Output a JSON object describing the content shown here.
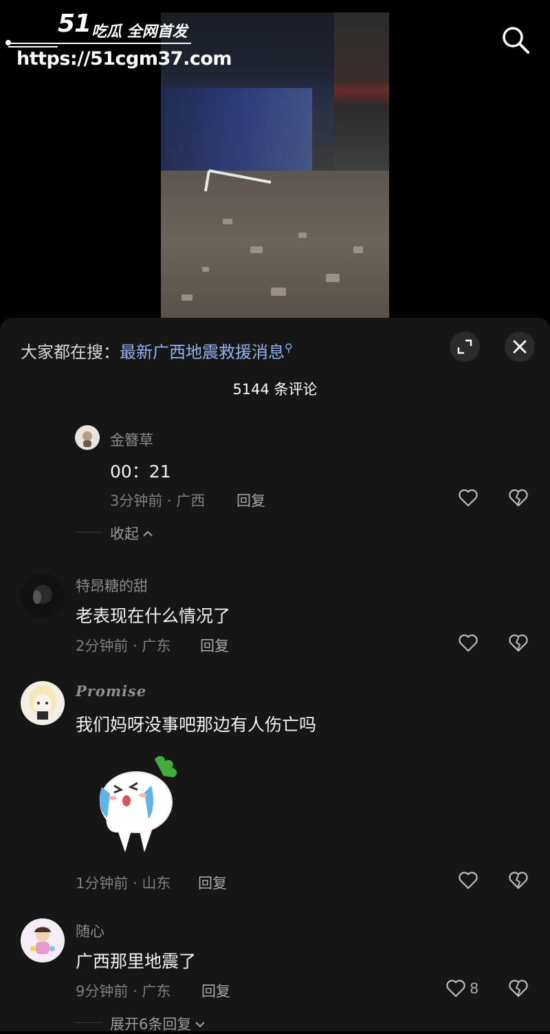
{
  "watermark": {
    "logo": "51",
    "tagline": "吃瓜 全网首发",
    "url": "https://51cgm37.com"
  },
  "sheet": {
    "search_prefix": "大家都在搜：",
    "search_link": "最新广西地震救援消息",
    "comment_count": "5144 条评论"
  },
  "comments": [
    {
      "username": "金簪草",
      "text": "00：21",
      "meta": "3分钟前 · 广西",
      "reply": "回复",
      "collapse": "收起"
    },
    {
      "username": "特昂糖的甜",
      "text": "老表现在什么情况了",
      "meta": "2分钟前 · 广东",
      "reply": "回复"
    },
    {
      "username": "Promise",
      "text": "我们妈呀没事吧那边有人伤亡吗",
      "meta": "1分钟前 · 山东",
      "reply": "回复"
    },
    {
      "username": "随心",
      "text": "广西那里地震了",
      "meta": "9分钟前 · 广东",
      "reply": "回复",
      "likes": "8",
      "expand": "展开6条回复"
    }
  ],
  "icons": {
    "search": "search-icon",
    "expand": "expand-icon",
    "close": "close-icon",
    "like": "heart-icon",
    "dislike": "broken-heart-icon"
  }
}
